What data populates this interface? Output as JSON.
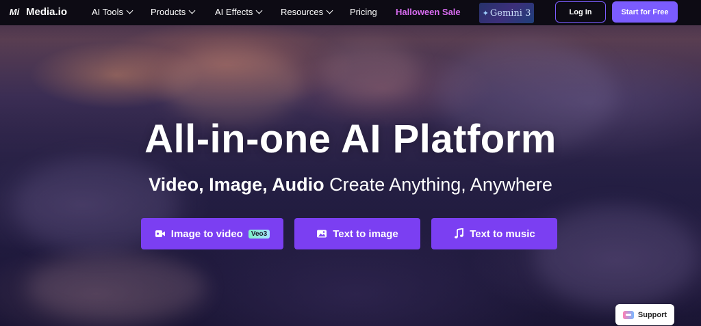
{
  "brand": {
    "logo_mark": "Mi",
    "name": "Media.io"
  },
  "nav": {
    "items": [
      {
        "label": "AI Tools",
        "has_dropdown": true
      },
      {
        "label": "Products",
        "has_dropdown": true
      },
      {
        "label": "AI Effects",
        "has_dropdown": true
      },
      {
        "label": "Resources",
        "has_dropdown": true
      },
      {
        "label": "Pricing",
        "has_dropdown": false
      },
      {
        "label": "Halloween Sale",
        "has_dropdown": false,
        "highlight": "#d86cf0"
      }
    ],
    "promo_banner": "Gemini 3",
    "login_label": "Log In",
    "start_label": "Start for Free"
  },
  "hero": {
    "headline": "All-in-one AI Platform",
    "subline_bold": "Video, Image, Audio",
    "subline_rest": " Create Anything, Anywhere",
    "ctas": [
      {
        "label": "Image to video",
        "icon": "video-camera-icon",
        "badge": "Veo3"
      },
      {
        "label": "Text to image",
        "icon": "image-icon"
      },
      {
        "label": "Text to music",
        "icon": "music-note-icon"
      }
    ]
  },
  "support": {
    "label": "Support",
    "icon": "chat-bubble-icon"
  },
  "colors": {
    "nav_bg": "#0d0b14",
    "accent": "#7b5cff",
    "cta_bg": "#7b3ff2",
    "sale": "#d86cf0"
  }
}
